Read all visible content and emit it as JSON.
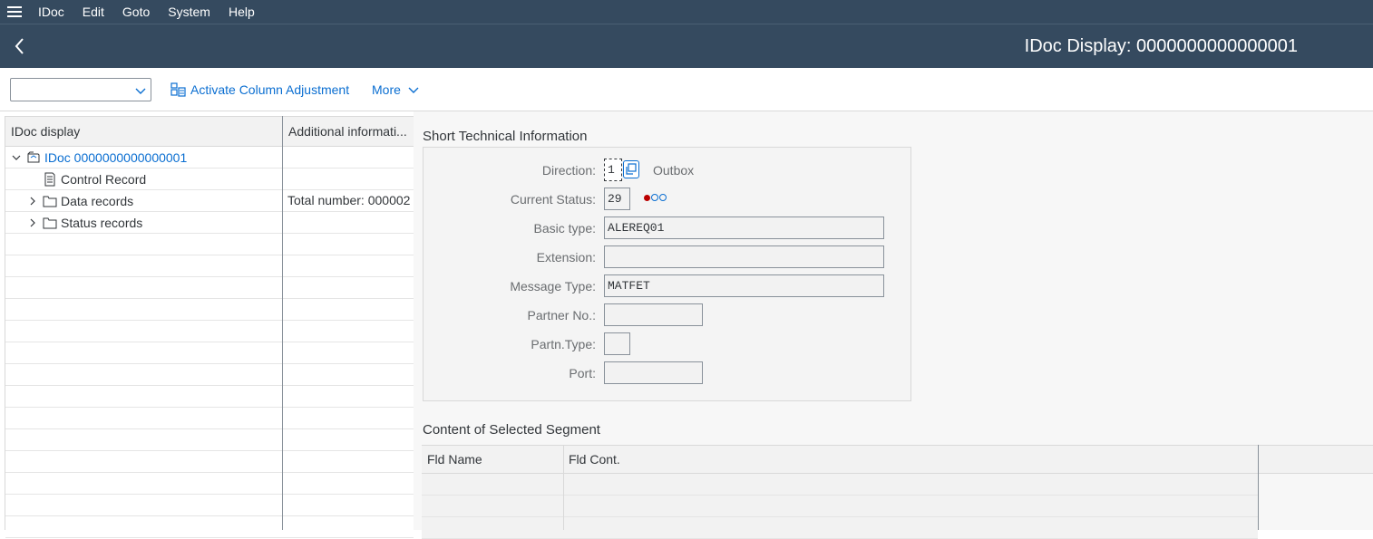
{
  "menu": {
    "items": [
      {
        "label": "IDoc"
      },
      {
        "label": "Edit"
      },
      {
        "label": "Goto"
      },
      {
        "label": "System"
      },
      {
        "label": "Help"
      }
    ]
  },
  "titlebar": {
    "title": "IDoc Display: 0000000000000001"
  },
  "toolbar": {
    "select_value": "",
    "activate_label": "Activate Column Adjustment",
    "more_label": "More"
  },
  "tree": {
    "columns": [
      "IDoc display",
      "Additional informati..."
    ],
    "rows": [
      {
        "label": "IDoc 0000000000000001",
        "info": "",
        "icon": "idoc-icon",
        "expander": "expanded"
      },
      {
        "label": "Control Record",
        "info": "",
        "icon": "document-icon",
        "expander": "none"
      },
      {
        "label": "Data records",
        "info": "Total number: 000002",
        "icon": "folder-icon",
        "expander": "collapsed"
      },
      {
        "label": "Status records",
        "info": "",
        "icon": "folder-icon",
        "expander": "collapsed"
      }
    ]
  },
  "tech_info": {
    "title": "Short Technical Information",
    "direction_label": "Direction:",
    "direction_value": "1",
    "direction_text": "Outbox",
    "status_label": "Current Status:",
    "status_value": "29",
    "basic_type_label": "Basic type:",
    "basic_type_value": "ALEREQ01",
    "extension_label": "Extension:",
    "extension_value": "",
    "message_type_label": "Message Type:",
    "message_type_value": "MATFET",
    "partner_no_label": "Partner No.:",
    "partner_no_value": "",
    "partn_type_label": "Partn.Type:",
    "partn_type_value": "",
    "port_label": "Port:",
    "port_value": ""
  },
  "segment": {
    "title": "Content of Selected Segment",
    "columns": [
      "Fld Name",
      "Fld Cont."
    ]
  },
  "colors": {
    "shell": "#354a5f",
    "link": "#0a6ed1",
    "status_red": "#bb0000"
  }
}
